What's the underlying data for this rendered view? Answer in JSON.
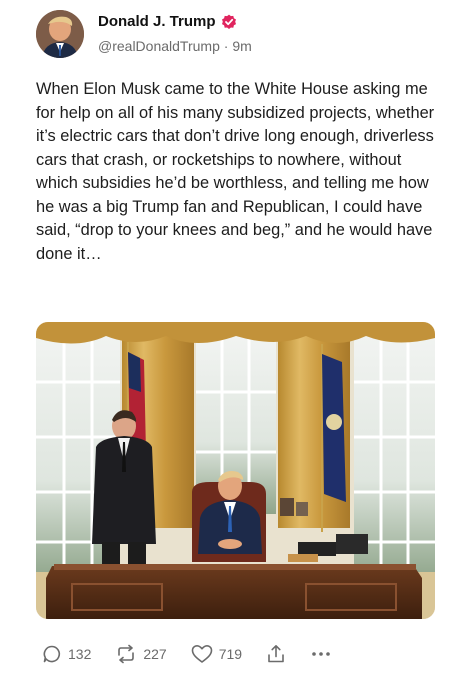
{
  "author": {
    "display_name": "Donald J. Trump",
    "handle": "@realDonaldTrump",
    "separator": "·",
    "timestamp": "9m",
    "avatar_icon": "profile-photo",
    "verified_color": "#e0245e"
  },
  "post": {
    "text": "When Elon Musk came to the White House asking me for help on all of his many subsidized projects, whether it’s electric cars that don’t drive long enough, driverless cars that crash, or rocketships to nowhere, without which subsidies he’d be worthless, and telling me how he was a big Trump fan and Republican, I could have said, “drop to your knees and beg,” and he would have done it…"
  },
  "actions": {
    "replies": "132",
    "reposts": "227",
    "likes": "719",
    "reply_icon": "reply-icon",
    "repost_icon": "repost-icon",
    "like_icon": "heart-icon",
    "share_icon": "share-icon",
    "more_icon": "more-icon"
  }
}
